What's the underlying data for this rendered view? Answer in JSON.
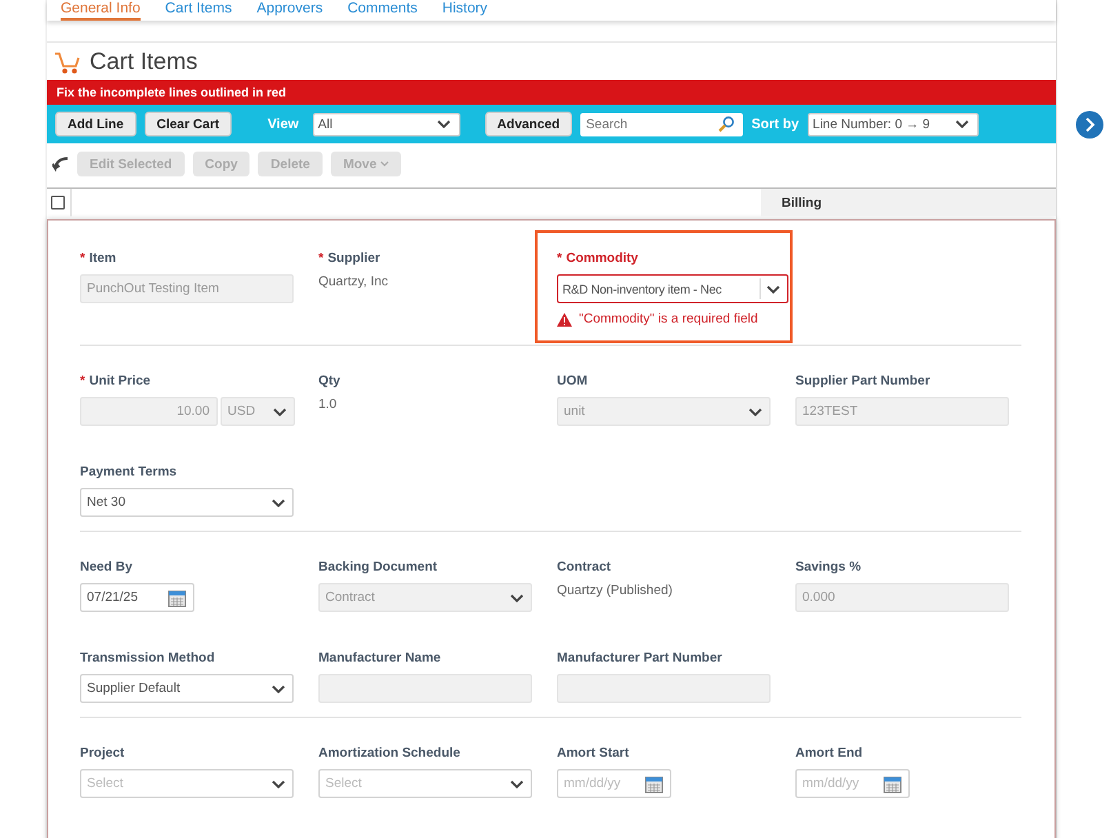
{
  "tabs": [
    {
      "label": "General Info",
      "selected": true
    },
    {
      "label": "Cart Items",
      "selected": false
    },
    {
      "label": "Approvers",
      "selected": false
    },
    {
      "label": "Comments",
      "selected": false
    },
    {
      "label": "History",
      "selected": false
    }
  ],
  "header": {
    "title": "Cart Items"
  },
  "error_banner": "Fix the incomplete lines outlined in red",
  "toolbar": {
    "buttons": [
      "Add Line",
      "Clear Cart"
    ],
    "view": {
      "label": "View",
      "value": "All"
    },
    "advanced": "Advanced",
    "search": {
      "placeholder": "Search"
    },
    "sort": {
      "label": "Sort by",
      "value": "Line Number: 0 → 9"
    }
  },
  "actions": [
    {
      "label": "Edit Selected",
      "disabled": true,
      "kind": "button"
    },
    {
      "label": "Copy",
      "disabled": true,
      "kind": "button"
    },
    {
      "label": "Delete",
      "disabled": true,
      "kind": "button"
    },
    {
      "label": "Move",
      "disabled": true,
      "kind": "menu"
    }
  ],
  "table": {
    "select_all": {
      "checked": false
    },
    "column_2": "Billing"
  },
  "required_mark": "*",
  "sections": [
    {
      "rows": [
        [
          {
            "label": "Item",
            "required": true,
            "kind": "input",
            "value": "PunchOut Testing Item",
            "disabled": true
          },
          {
            "label": "Supplier",
            "required": true,
            "kind": "text",
            "value": "Quartzy, Inc"
          },
          {
            "label": "Commodity",
            "required": true,
            "kind": "select",
            "value": "R&D Non-inventory item - Nec",
            "disabled": false,
            "error": "\"Commodity\" is a required field"
          }
        ]
      ]
    },
    {
      "rows": [
        [
          {
            "label": "Unit Price",
            "required": true,
            "kind": "price",
            "value": "10.00",
            "disabled": true,
            "currency": {
              "value": "USD",
              "disabled": true
            }
          },
          {
            "label": "Qty",
            "required": false,
            "kind": "text",
            "value": "1.0"
          },
          {
            "label": "UOM",
            "required": false,
            "kind": "select",
            "value": "unit",
            "disabled": true
          },
          {
            "label": "Supplier Part Number",
            "required": false,
            "kind": "input",
            "value": "123TEST",
            "disabled": true
          }
        ],
        [
          {
            "label": "Payment Terms",
            "required": false,
            "kind": "select",
            "value": "Net 30",
            "disabled": false
          }
        ]
      ]
    },
    {
      "rows": [
        [
          {
            "label": "Need By",
            "required": false,
            "kind": "date",
            "value": "07/21/25"
          },
          {
            "label": "Backing Document",
            "required": false,
            "kind": "select",
            "value": "Contract",
            "disabled": true
          },
          {
            "label": "Contract",
            "required": false,
            "kind": "text",
            "value": "Quartzy (Published)"
          },
          {
            "label": "Savings %",
            "required": false,
            "kind": "input",
            "value": "0.000",
            "disabled": true
          }
        ],
        [
          {
            "label": "Transmission Method",
            "required": false,
            "kind": "select",
            "value": "Supplier Default",
            "disabled": false
          },
          {
            "label": "Manufacturer Name",
            "required": false,
            "kind": "input",
            "disabled": true
          },
          {
            "label": "Manufacturer Part Number",
            "required": false,
            "kind": "input",
            "disabled": true
          }
        ]
      ]
    },
    {
      "rows": [
        [
          {
            "label": "Project",
            "required": false,
            "kind": "select",
            "placeholder": "Select",
            "disabled": false
          },
          {
            "label": "Amortization Schedule",
            "required": false,
            "kind": "select",
            "placeholder": "Select",
            "disabled": false
          },
          {
            "label": "Amort Start",
            "required": false,
            "kind": "date",
            "placeholder": "mm/dd/yy"
          },
          {
            "label": "Amort End",
            "required": false,
            "kind": "date",
            "placeholder": "mm/dd/yy"
          }
        ]
      ]
    }
  ]
}
